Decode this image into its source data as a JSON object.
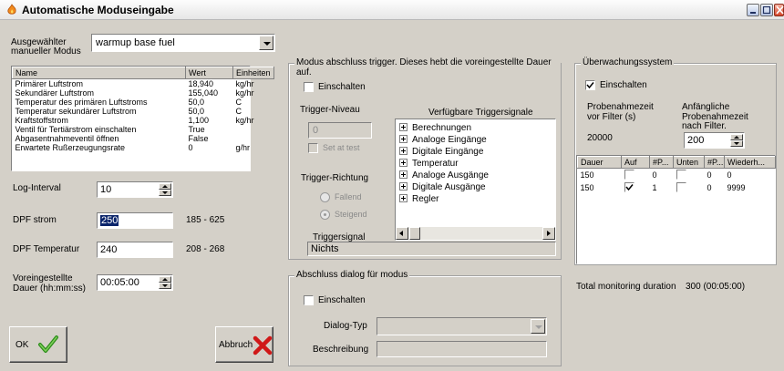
{
  "window": {
    "title": "Automatische Moduseingabe"
  },
  "mode": {
    "label_line1": "Ausgewählter",
    "label_line2": "manueller Modus",
    "selected": "warmup base fuel"
  },
  "params_table": {
    "headers": [
      "Name",
      "Wert",
      "Einheiten"
    ],
    "rows": [
      [
        "Primärer Luftstrom",
        "18,940",
        "kg/hr"
      ],
      [
        "Sekundärer Luftstrom",
        "155,040",
        "kg/hr"
      ],
      [
        "Temperatur des primären Luftstroms",
        "50,0",
        "C"
      ],
      [
        "Temperatur sekundärer Luftstrom",
        "50,0",
        "C"
      ],
      [
        "Kraftstoffstrom",
        "1,100",
        "kg/hr"
      ],
      [
        "Ventil für Tertiärstrom einschalten",
        "True",
        ""
      ],
      [
        "Abgasentnahmeventil öffnen",
        "False",
        ""
      ],
      [
        "Erwartete Rußerzeugungsrate",
        "0",
        "g/hr"
      ]
    ]
  },
  "log_interval": {
    "label": "Log-Interval",
    "value": "10"
  },
  "dpf_strom": {
    "label": "DPF strom",
    "value": "250",
    "range": "185 - 625"
  },
  "dpf_temp": {
    "label": "DPF Temperatur",
    "value": "240",
    "range": "208 - 268"
  },
  "duration": {
    "label_line1": "Voreingestellte",
    "label_line2": "Dauer (hh:mm:ss)",
    "value": "00:05:00"
  },
  "ok_button": {
    "label": "OK"
  },
  "cancel_button": {
    "label": "Abbruch"
  },
  "trigger": {
    "group_title": "Modus abschluss trigger. Dieses hebt die voreingestellte Dauer auf.",
    "enable_label": "Einschalten",
    "level_label": "Trigger-Niveau",
    "level_value": "0",
    "set_at_test": "Set at test",
    "direction_label": "Trigger-Richtung",
    "falling": "Fallend",
    "rising": "Steigend",
    "signals_header": "Verfügbare Triggersignale",
    "signals": [
      "Berechnungen",
      "Analoge Eingänge",
      "Digitale Eingänge",
      "Temperatur",
      "Analoge Ausgänge",
      "Digitale Ausgänge",
      "Regler"
    ],
    "signal_label": "Triggersignal",
    "signal_value": "Nichts"
  },
  "dialog": {
    "group_title": "Abschluss dialog für modus",
    "enable_label": "Einschalten",
    "type_label": "Dialog-Typ",
    "desc_label": "Beschreibung"
  },
  "monitoring": {
    "group_title": "Überwachungssystem",
    "enable_label": "Einschalten",
    "sample_before_l1": "Probenahmezeit",
    "sample_before_l2": "vor Filter (s)",
    "sample_before_value": "20000",
    "initial_l1": "Anfängliche",
    "initial_l2": "Probenahmezeit",
    "initial_l3": "nach Filter.",
    "initial_value": "200",
    "table_headers": [
      "Dauer",
      "Auf",
      "#P...",
      "Unten",
      "#P...",
      "Wiederh..."
    ],
    "rows": [
      {
        "dauer": "150",
        "auf": false,
        "p1": "0",
        "unten": false,
        "p2": "0",
        "wdh": "0"
      },
      {
        "dauer": "150",
        "auf": true,
        "p1": "1",
        "unten": false,
        "p2": "0",
        "wdh": "9999"
      }
    ],
    "total_label": "Total monitoring duration",
    "total_value": "300 (00:05:00)"
  }
}
